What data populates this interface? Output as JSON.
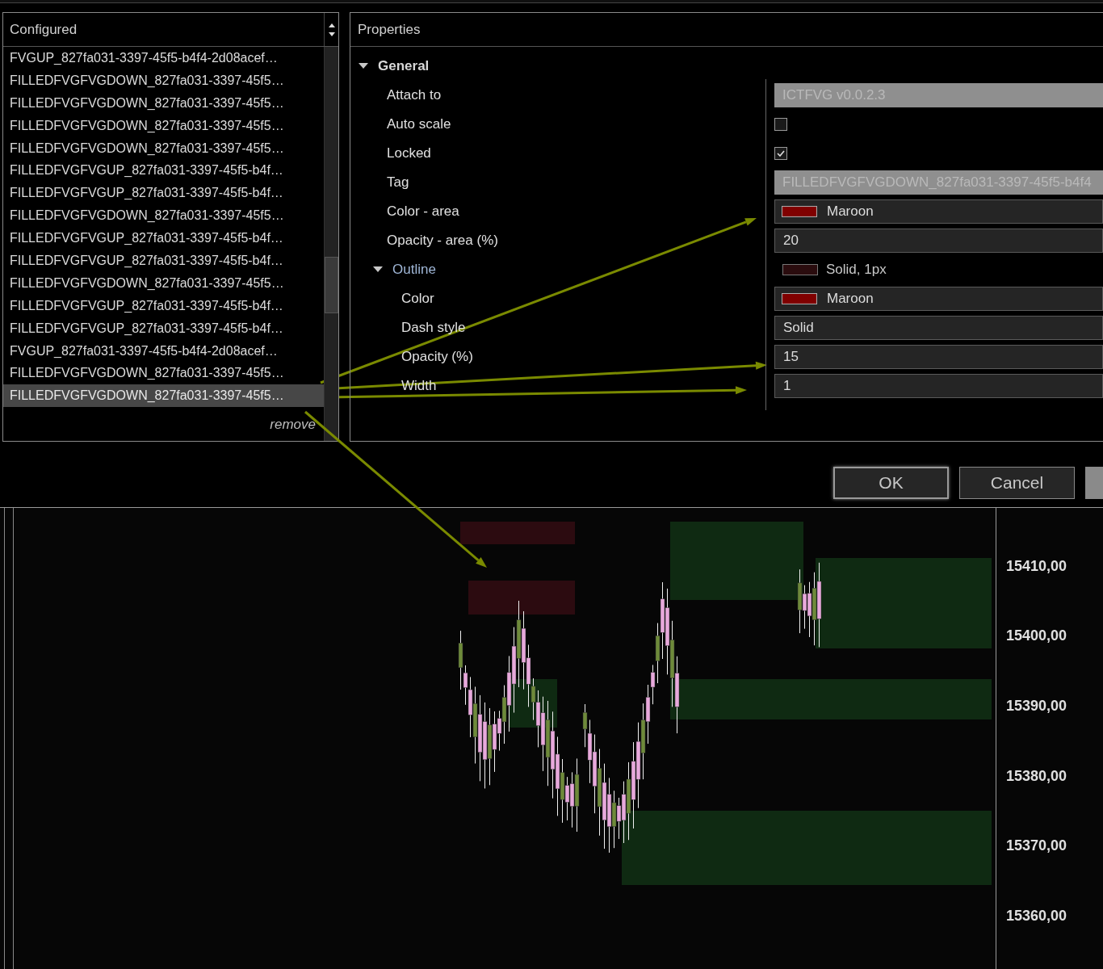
{
  "configured": {
    "title": "Configured",
    "items": [
      {
        "label": "FVGUP_827fa031-3397-45f5-b4f4-2d08acef…",
        "selected": false
      },
      {
        "label": "FILLEDFVGFVGDOWN_827fa031-3397-45f5…",
        "selected": false
      },
      {
        "label": "FILLEDFVGFVGDOWN_827fa031-3397-45f5…",
        "selected": false
      },
      {
        "label": "FILLEDFVGFVGDOWN_827fa031-3397-45f5…",
        "selected": false
      },
      {
        "label": "FILLEDFVGFVGDOWN_827fa031-3397-45f5…",
        "selected": false
      },
      {
        "label": "FILLEDFVGFVGUP_827fa031-3397-45f5-b4f…",
        "selected": false
      },
      {
        "label": "FILLEDFVGFVGUP_827fa031-3397-45f5-b4f…",
        "selected": false
      },
      {
        "label": "FILLEDFVGFVGDOWN_827fa031-3397-45f5…",
        "selected": false
      },
      {
        "label": "FILLEDFVGFVGUP_827fa031-3397-45f5-b4f…",
        "selected": false
      },
      {
        "label": "FILLEDFVGFVGUP_827fa031-3397-45f5-b4f…",
        "selected": false
      },
      {
        "label": "FILLEDFVGFVGDOWN_827fa031-3397-45f5…",
        "selected": false
      },
      {
        "label": "FILLEDFVGFVGUP_827fa031-3397-45f5-b4f…",
        "selected": false
      },
      {
        "label": "FILLEDFVGFVGUP_827fa031-3397-45f5-b4f…",
        "selected": false
      },
      {
        "label": "FVGUP_827fa031-3397-45f5-b4f4-2d08acef…",
        "selected": false
      },
      {
        "label": "FILLEDFVGFVGDOWN_827fa031-3397-45f5…",
        "selected": false
      },
      {
        "label": "FILLEDFVGFVGDOWN_827fa031-3397-45f5…",
        "selected": true
      }
    ],
    "remove": "remove"
  },
  "properties": {
    "title": "Properties",
    "tree": [
      {
        "label": "General",
        "kind": "group",
        "expanded": true,
        "children": [
          {
            "label": "Attach to",
            "kind": "readonly",
            "value": "ICTFVG v0.0.2.3"
          },
          {
            "label": "Auto scale",
            "kind": "checkbox",
            "checked": false
          },
          {
            "label": "Locked",
            "kind": "checkbox",
            "checked": true
          },
          {
            "label": "Tag",
            "kind": "readonly",
            "value": "FILLEDFVGFVGDOWN_827fa031-3397-45f5-b4f4"
          },
          {
            "label": "Color - area",
            "kind": "color",
            "color": "#800000",
            "value": "Maroon"
          },
          {
            "label": "Opacity - area (%)",
            "kind": "text",
            "value": "20"
          },
          {
            "label": "Outline",
            "kind": "group",
            "expanded": true,
            "color": "#2a0c0e",
            "value": "Solid, 1px",
            "children": [
              {
                "label": "Color",
                "kind": "color",
                "color": "#800000",
                "value": "Maroon"
              },
              {
                "label": "Dash style",
                "kind": "text",
                "value": "Solid"
              },
              {
                "label": "Opacity (%)",
                "kind": "text",
                "value": "15"
              },
              {
                "label": "Width",
                "kind": "text",
                "value": "1"
              }
            ]
          }
        ]
      }
    ]
  },
  "buttons": [
    {
      "label": "OK",
      "kind": "default"
    },
    {
      "label": "Cancel",
      "kind": "normal"
    },
    {
      "kind": "cut"
    }
  ],
  "price_axis": [
    "15410,00",
    "15400,00",
    "15390,00",
    "15380,00",
    "15370,00",
    "15360,00"
  ]
}
